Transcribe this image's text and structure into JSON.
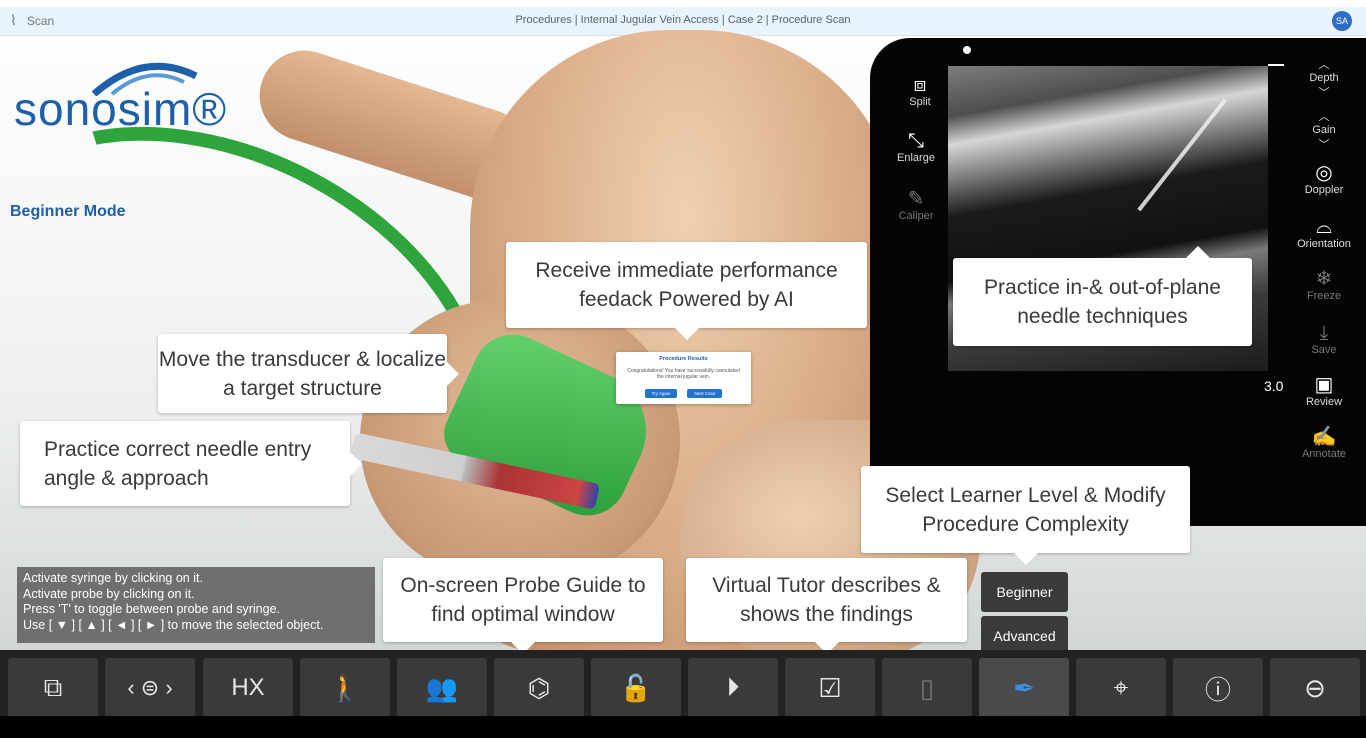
{
  "topbar": {
    "app_label": "Scan",
    "breadcrumb": "Procedures | Internal Jugular Vein Access | Case 2 | Procedure Scan",
    "avatar": "SA"
  },
  "logo": {
    "text": "sonosim®"
  },
  "mode_label": "Beginner Mode",
  "callouts": {
    "feedback": "Receive immediate performance feedack Powered by AI",
    "transducer": "Move the transducer & localize a target structure",
    "needle_angle": "Practice correct needle entry angle & approach",
    "in_out_plane": "Practice in-& out-of-plane needle techniques",
    "learner_level": "Select Learner Level & Modify Procedure Complexity",
    "probe_guide": "On-screen Probe Guide to find optimal window",
    "virtual_tutor": "Virtual Tutor describes & shows the findings"
  },
  "results_dialog": {
    "title": "Procedure Results",
    "message": "Congratulations! You have successfully cannulated the internal jugular vein.",
    "try_again": "Try Again",
    "next_case": "Next Case"
  },
  "device": {
    "depth_value": "3.0",
    "left_tools": [
      {
        "label": "Split",
        "icon": "split-icon"
      },
      {
        "label": "Enlarge",
        "icon": "enlarge-icon"
      },
      {
        "label": "Caliper",
        "icon": "caliper-icon"
      }
    ],
    "right_tools": [
      {
        "label": "Depth",
        "icon": "depth-arrows-icon"
      },
      {
        "label": "Gain",
        "icon": "gain-arrows-icon"
      },
      {
        "label": "Doppler",
        "icon": "doppler-icon"
      },
      {
        "label": "Orientation",
        "icon": "orientation-icon"
      },
      {
        "label": "Freeze",
        "icon": "freeze-icon"
      },
      {
        "label": "Save",
        "icon": "save-icon"
      },
      {
        "label": "Review",
        "icon": "review-icon"
      },
      {
        "label": "Annotate",
        "icon": "annotate-icon"
      }
    ]
  },
  "instructions": [
    "Activate syringe by clicking on it.",
    "Activate probe by clicking on it.",
    "Press 'T' to toggle between probe and syringe.",
    "Use [ ▼ ] [ ▲ ] [ ◄ ] [ ► ] to move the selected object."
  ],
  "levels": {
    "beginner": "Beginner",
    "advanced": "Advanced"
  },
  "toolbar": {
    "hx_label": "HX",
    "accent_color": "#3d8de0",
    "icons": [
      "probe-layout-icon",
      "probe-switch-icon",
      "history-icon",
      "patient-position-icon",
      "team-icon",
      "probe-guide-icon",
      "lock-icon",
      "play-icon",
      "findings-icon",
      "probe-device-icon",
      "syringe-icon",
      "crosshair-icon",
      "help-icon",
      "exit-icon"
    ]
  }
}
